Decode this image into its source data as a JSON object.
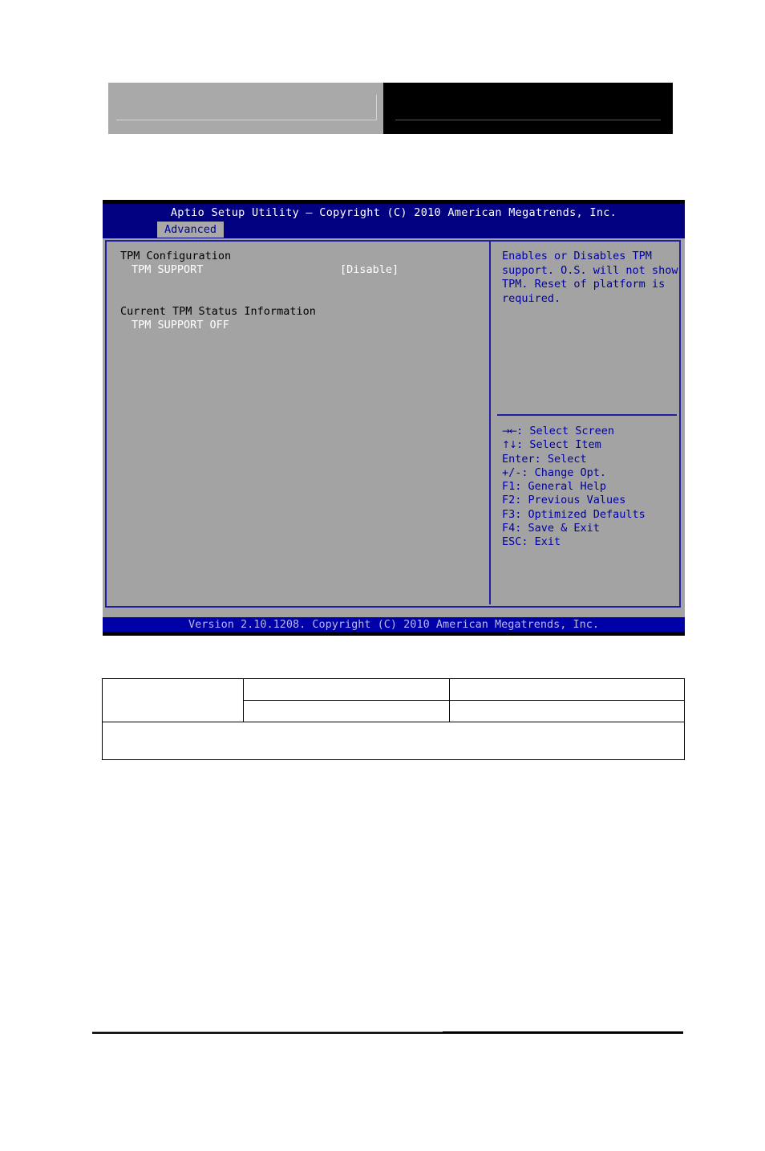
{
  "page": {
    "header_blocks": [
      {
        "name": "left-block",
        "color": "#a9a9a9",
        "text": ""
      },
      {
        "name": "right-block",
        "color": "#000000",
        "text": ""
      }
    ]
  },
  "bios": {
    "title": "Aptio Setup Utility – Copyright (C) 2010 American Megatrends, Inc.",
    "active_tab": "Advanced",
    "tabs": [
      "Advanced"
    ],
    "colors": {
      "background": "#000080",
      "body": "#a3a3a3",
      "border": "#2020a0",
      "help_text": "#0000a0",
      "value_text": "#ffffff",
      "header_text": "#000000"
    },
    "left_pane": {
      "section_title": "TPM Configuration",
      "items": [
        {
          "label": "TPM SUPPORT",
          "value": "[Disable]"
        }
      ],
      "status_title": "Current TPM Status Information",
      "status_items": [
        {
          "label": "TPM SUPPORT OFF"
        }
      ]
    },
    "right_pane": {
      "help_lines": [
        "Enables or Disables TPM",
        "support. O.S. will not show",
        "TPM. Reset of platform is",
        "required."
      ],
      "key_legend": [
        {
          "glyph": "→←",
          "text": ": Select Screen"
        },
        {
          "glyph": "↑↓",
          "text": ": Select Item"
        },
        {
          "glyph": "",
          "text": "Enter: Select"
        },
        {
          "glyph": "",
          "text": "+/-: Change Opt."
        },
        {
          "glyph": "",
          "text": "F1: General Help"
        },
        {
          "glyph": "",
          "text": "F2: Previous Values"
        },
        {
          "glyph": "",
          "text": "F3: Optimized Defaults"
        },
        {
          "glyph": "",
          "text": "F4: Save & Exit"
        },
        {
          "glyph": "",
          "text": "ESC: Exit"
        }
      ]
    },
    "footer": "Version 2.10.1208. Copyright (C) 2010 American Megatrends, Inc."
  },
  "bottom_table": {
    "rows": [
      {
        "cells": [
          "",
          "",
          ""
        ]
      },
      {
        "cells": [
          "",
          ""
        ]
      },
      {
        "cells": [
          ""
        ]
      }
    ]
  }
}
